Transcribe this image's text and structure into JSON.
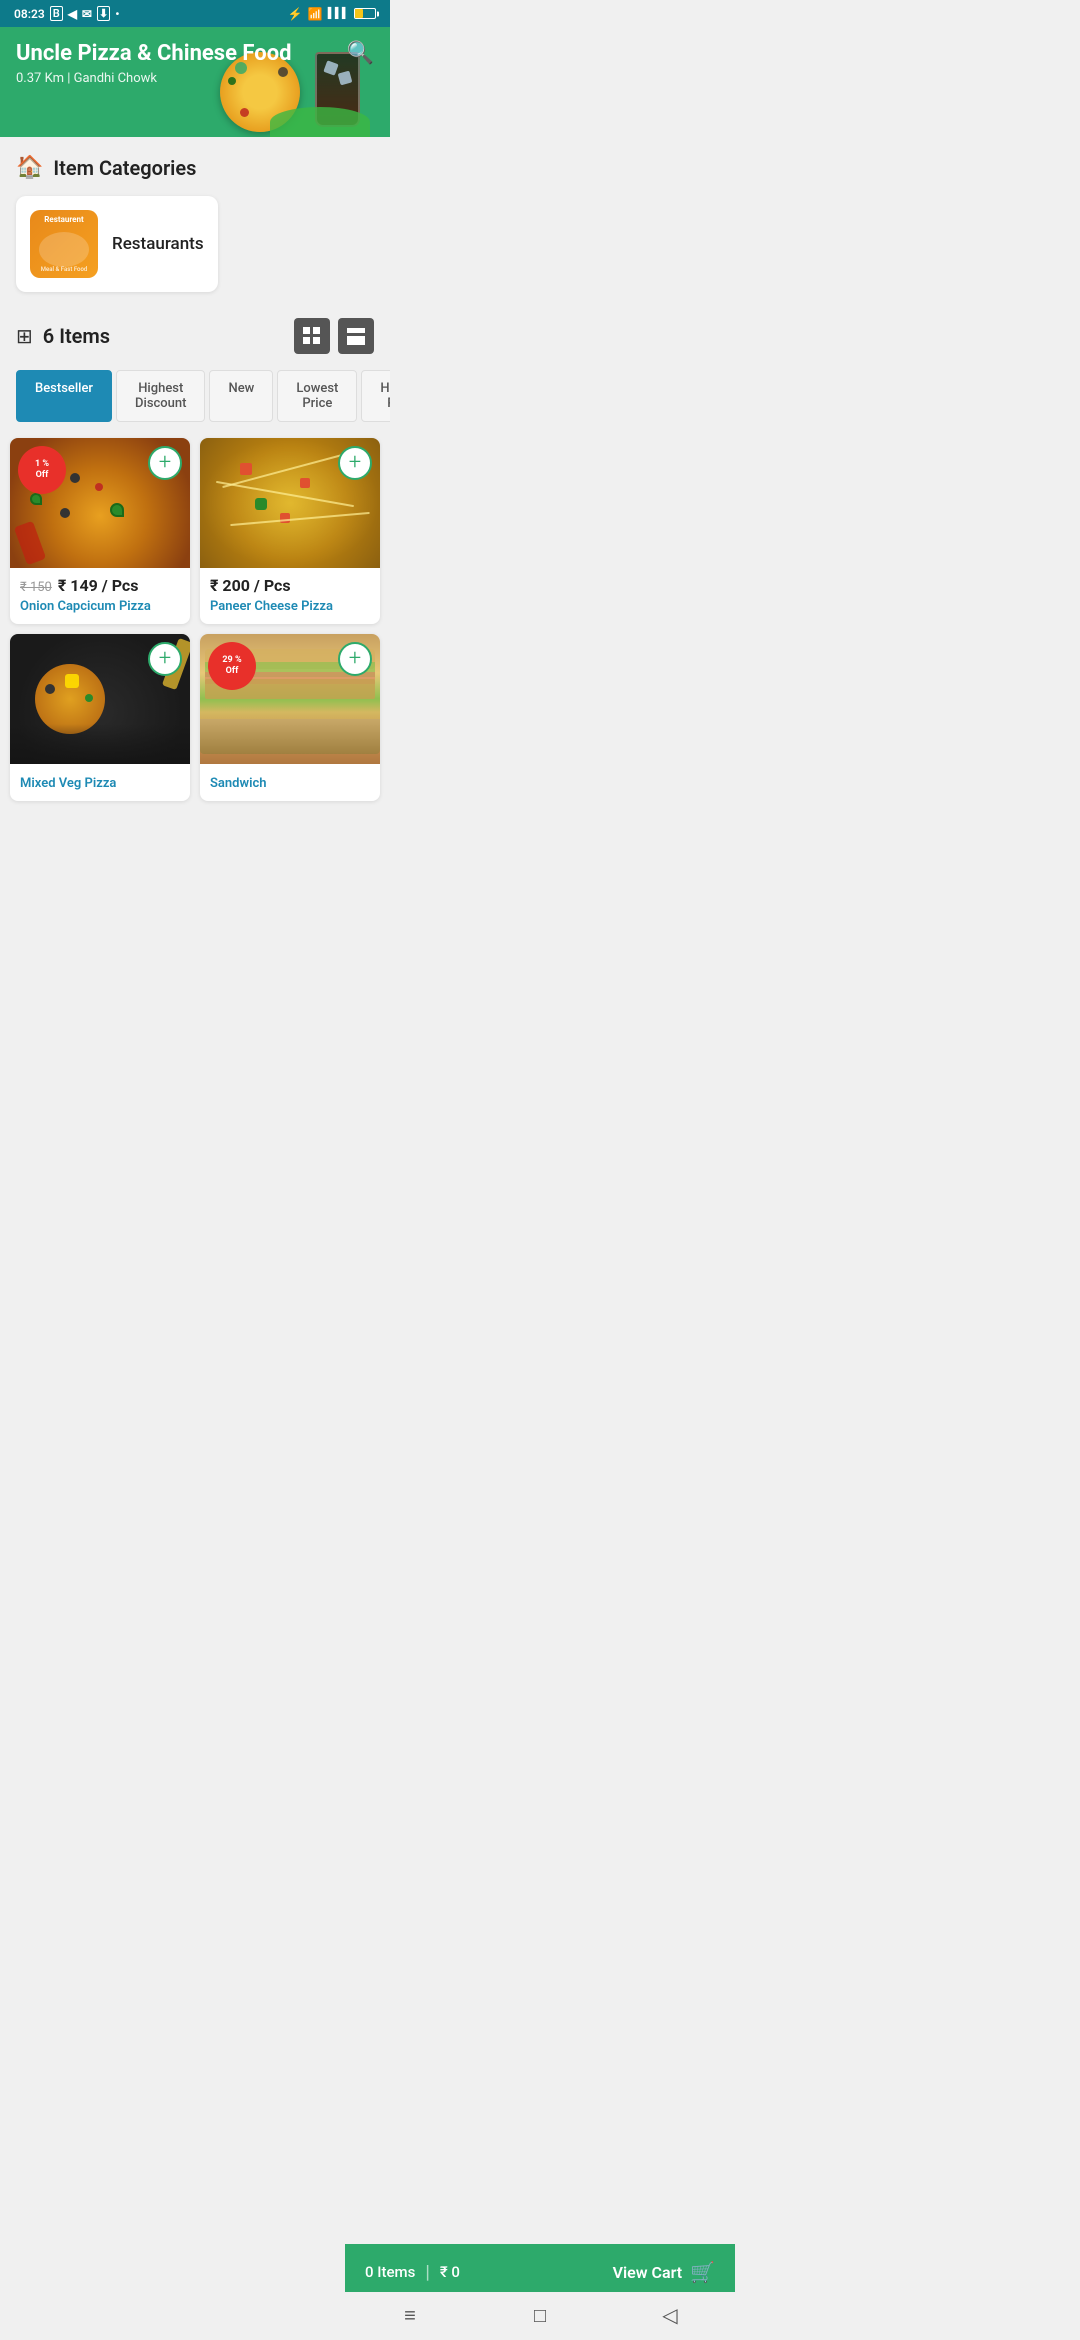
{
  "statusBar": {
    "time": "08:23",
    "batteryPercent": 40
  },
  "header": {
    "restaurantName": "Uncle Pizza & Chinese Food",
    "distance": "0.37 Km | Gandhi Chowk",
    "searchLabel": "search"
  },
  "itemCategories": {
    "sectionTitle": "Item Categories",
    "categoryName": "Restaurants",
    "categoryIconLabel": "Restaurent",
    "categoryIconSub": "Meal & Fast Food"
  },
  "itemsSection": {
    "itemCount": "6",
    "itemsLabel": "Items"
  },
  "filterTabs": [
    {
      "id": "bestseller",
      "label": "Bestseller",
      "active": true
    },
    {
      "id": "highest-discount",
      "label": "Highest Discount",
      "active": false
    },
    {
      "id": "new",
      "label": "New",
      "active": false
    },
    {
      "id": "lowest-price",
      "label": "Lowest Price",
      "active": false
    },
    {
      "id": "highest-price",
      "label": "Highest Price",
      "active": false
    }
  ],
  "products": [
    {
      "id": "p1",
      "name": "Onion Capcicum Pizza",
      "priceOriginal": "₹ 150",
      "priceCurrent": "₹ 149 / Pcs",
      "discount": "1 % Off",
      "hasDiscount": true,
      "imageType": "pizza1"
    },
    {
      "id": "p2",
      "name": "Paneer Cheese Pizza",
      "priceOriginal": "",
      "priceCurrent": "₹ 200 / Pcs",
      "discount": "",
      "hasDiscount": false,
      "imageType": "pizza2"
    },
    {
      "id": "p3",
      "name": "Mixed Veg Pizza",
      "priceOriginal": "",
      "priceCurrent": "",
      "discount": "",
      "hasDiscount": false,
      "imageType": "pizza3"
    },
    {
      "id": "p4",
      "name": "Sandwich",
      "priceOriginal": "",
      "priceCurrent": "",
      "discount": "29 % Off",
      "hasDiscount": true,
      "imageType": "sandwich"
    }
  ],
  "cartBar": {
    "itemCount": "0 Items",
    "price": "₹ 0",
    "viewCartLabel": "View Cart",
    "divider": "|"
  },
  "bottomNav": {
    "menuIcon": "≡",
    "homeIcon": "□",
    "backIcon": "◁"
  }
}
